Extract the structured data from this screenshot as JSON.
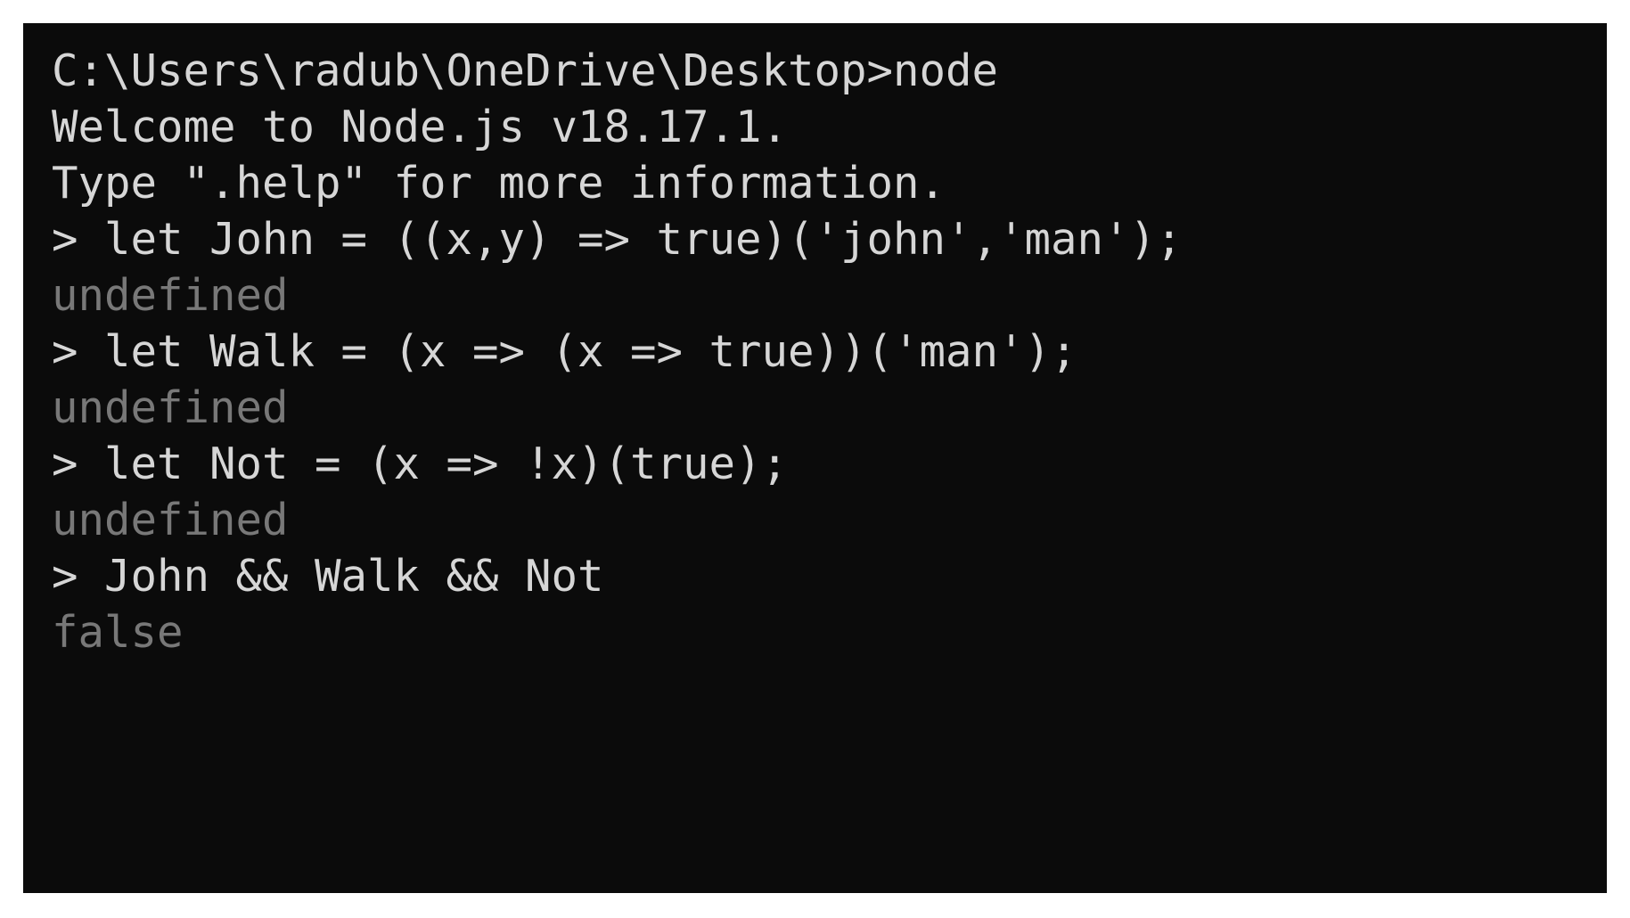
{
  "terminal": {
    "app": "Windows Command Prompt",
    "program": "node",
    "background_color": "#0b0b0b",
    "page_background_color": "#ffffff",
    "input_text_color": "#d6d6d6",
    "output_text_color": "#787878",
    "prompt_symbol": ">",
    "working_directory": "C:\\Users\\radub\\OneDrive\\Desktop",
    "node_version": "v18.17.1",
    "lines": [
      {
        "id": "line-1",
        "kind": "banner",
        "text": "C:\\Users\\radub\\OneDrive\\Desktop>node"
      },
      {
        "id": "line-2",
        "kind": "banner",
        "text": "Welcome to Node.js v18.17.1."
      },
      {
        "id": "line-3",
        "kind": "banner",
        "text": "Type \".help\" for more information."
      },
      {
        "id": "line-4",
        "kind": "input",
        "text": "> let John = ((x,y) => true)('john','man');"
      },
      {
        "id": "line-5",
        "kind": "output",
        "text": "undefined"
      },
      {
        "id": "line-6",
        "kind": "input",
        "text": "> let Walk = (x => (x => true))('man');"
      },
      {
        "id": "line-7",
        "kind": "output",
        "text": "undefined"
      },
      {
        "id": "line-8",
        "kind": "input",
        "text": "> let Not = (x => !x)(true);"
      },
      {
        "id": "line-9",
        "kind": "output",
        "text": "undefined"
      },
      {
        "id": "line-10",
        "kind": "input",
        "text": "> John && Walk && Not"
      },
      {
        "id": "line-11",
        "kind": "output",
        "text": "false"
      }
    ]
  }
}
